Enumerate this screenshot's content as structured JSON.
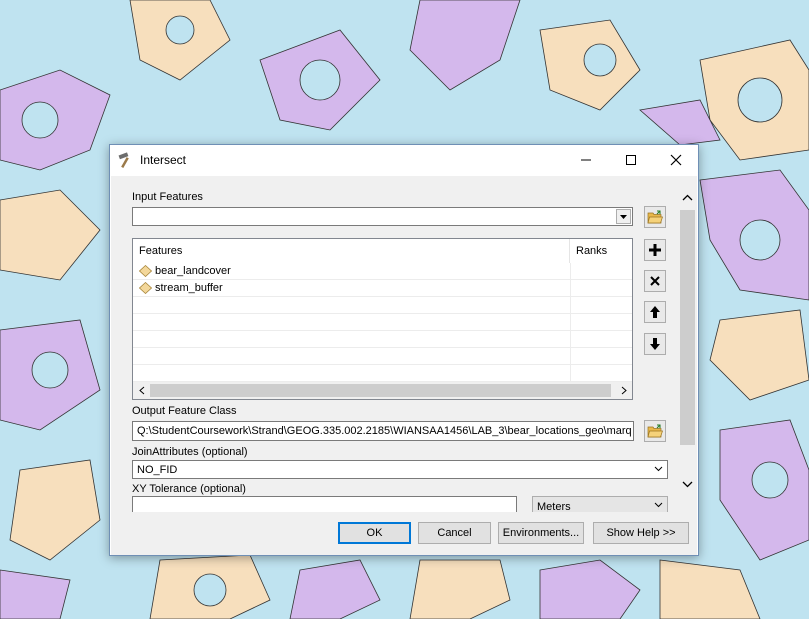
{
  "window": {
    "title": "Intersect"
  },
  "input_features": {
    "label": "Input Features",
    "value": "",
    "table": {
      "columns": [
        "Features",
        "Ranks"
      ],
      "rows": [
        {
          "name": "bear_landcover",
          "rank": ""
        },
        {
          "name": "stream_buffer",
          "rank": ""
        }
      ]
    }
  },
  "output_feature_class": {
    "label": "Output Feature Class",
    "value": "Q:\\StudentCoursework\\Strand\\GEOG.335.002.2185\\WIANSAA1456\\LAB_3\\bear_locations_geo\\marqu"
  },
  "join_attributes": {
    "label": "JoinAttributes (optional)",
    "value": "NO_FID"
  },
  "xy_tolerance": {
    "label": "XY Tolerance (optional)",
    "value": "",
    "unit": "Meters"
  },
  "buttons": {
    "ok": "OK",
    "cancel": "Cancel",
    "environments": "Environments...",
    "show_help": "Show Help >>"
  },
  "icons": {
    "title": "hammer-icon",
    "browse": "open-folder-icon",
    "add": "plus-icon",
    "remove": "x-icon",
    "up": "arrow-up-icon",
    "down": "arrow-down-icon",
    "feature": "polygon-feature-icon"
  },
  "colors": {
    "map_water": "#bfe3f0",
    "map_sand": "#f7dfbd",
    "map_violet": "#d4b8ec",
    "accent": "#0078d7"
  }
}
